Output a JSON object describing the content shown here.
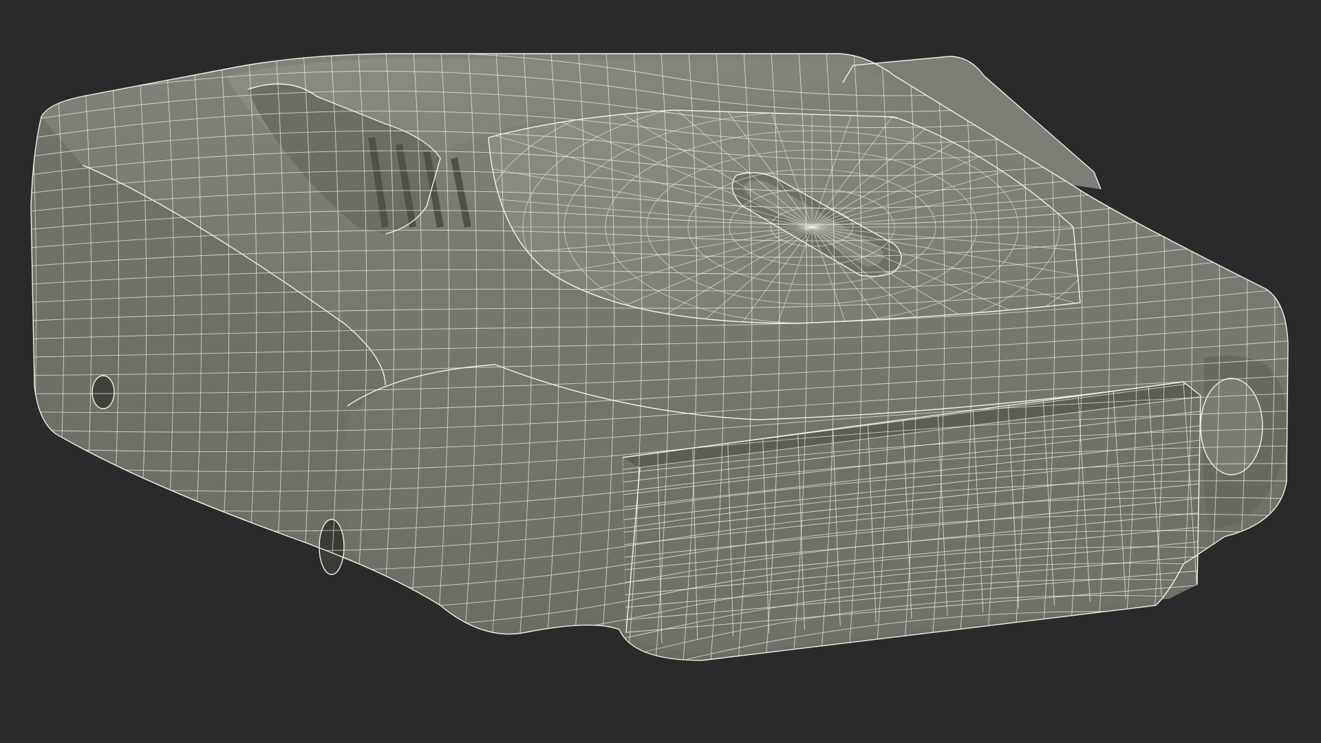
{
  "scene": {
    "background_color": "#2a2a2a",
    "mesh_fill_color": "#75776d",
    "mesh_shadow_color": "#5f6157",
    "mesh_highlight_color": "#8a8c82",
    "wireframe_color": "#f2f2ea",
    "object_icon": "wireframe-mesh-icon"
  }
}
